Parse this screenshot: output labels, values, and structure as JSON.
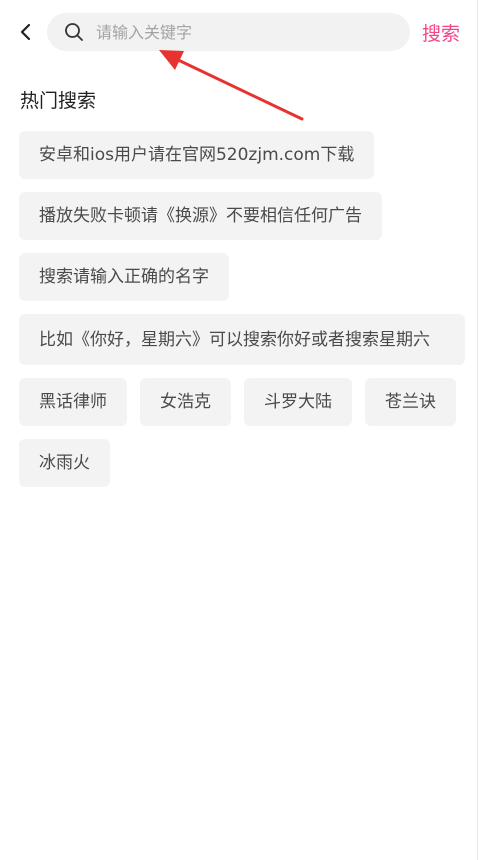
{
  "search": {
    "placeholder": "请输入关键字",
    "button_label": "搜索"
  },
  "hot": {
    "title": "热门搜索",
    "tags": [
      "安卓和ios用户请在官网520zjm.com下载",
      "播放失败卡顿请《换源》不要相信任何广告",
      "搜索请输入正确的名字",
      "比如《你好，星期六》可以搜索你好或者搜索星期六",
      "黑话律师",
      "女浩克",
      "斗罗大陆",
      "苍兰诀",
      "冰雨火"
    ]
  },
  "icons": {
    "back": "chevron-left-icon",
    "search": "search-icon",
    "annotation": "red-arrow-icon"
  },
  "colors": {
    "accent": "#f0468a",
    "tag_bg": "#f3f3f3",
    "search_bg": "#f2f2f2",
    "annotation": "#e8322f"
  }
}
